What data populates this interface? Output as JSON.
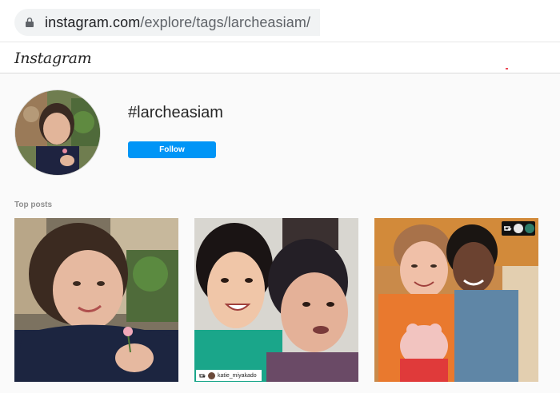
{
  "browser": {
    "url_domain": "instagram.com",
    "url_path": "/explore/tags/larcheasiam/",
    "lock_icon": "lock-icon"
  },
  "header": {
    "logo_text": "Instagram"
  },
  "profile": {
    "hashtag": "#larcheasiam",
    "follow_label": "Follow"
  },
  "section": {
    "top_posts_label": "Top posts"
  },
  "posts": [
    {
      "id": "post-1"
    },
    {
      "id": "post-2",
      "repost_username": "katie_miyakado",
      "repost_icon": "repost-icon"
    },
    {
      "id": "post-3",
      "badge_icon": "repost-icon"
    }
  ],
  "colors": {
    "follow_blue": "#0095f6",
    "background": "#fafafa"
  }
}
